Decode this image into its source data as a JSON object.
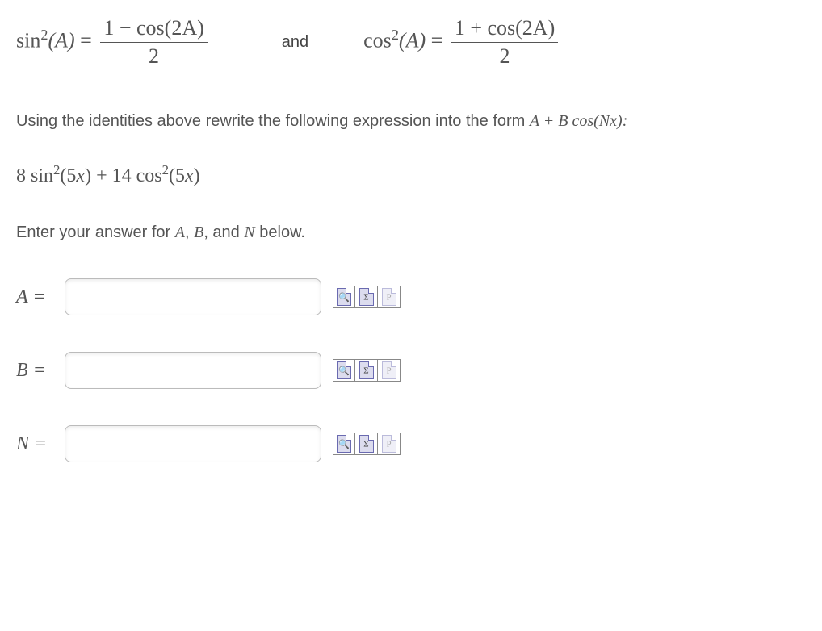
{
  "identities": {
    "sin_lhs_fn": "sin",
    "sin_lhs_var": "A",
    "sin_rhs_num": "1 − cos(2A)",
    "sin_rhs_den": "2",
    "and": "and",
    "cos_lhs_fn": "cos",
    "cos_lhs_var": "A",
    "cos_rhs_num": "1 + cos(2A)",
    "cos_rhs_den": "2"
  },
  "instruction": {
    "prefix": "Using the identities above rewrite the following expression into the form ",
    "form_A": "A",
    "form_plus": " + ",
    "form_B": "B",
    "form_cos": " cos(",
    "form_N": "N",
    "form_x": "x",
    "form_close": "):"
  },
  "expression": {
    "coef1": "8",
    "fn1": "sin",
    "arg1": "5x",
    "plus": " + ",
    "coef2": "14",
    "fn2": "cos",
    "arg2": "5x"
  },
  "enter_prompt": {
    "prefix": "Enter your answer for ",
    "A": "A",
    "sep1": ", ",
    "B": "B",
    "sep2": ", and ",
    "N": "N",
    "suffix": " below."
  },
  "answers": {
    "A_label": "A =",
    "B_label": "B =",
    "N_label": "N =",
    "A_value": "",
    "B_value": "",
    "N_value": ""
  },
  "buttons": {
    "preview": "Preview",
    "equation": "Equation editor",
    "help": "Help"
  }
}
